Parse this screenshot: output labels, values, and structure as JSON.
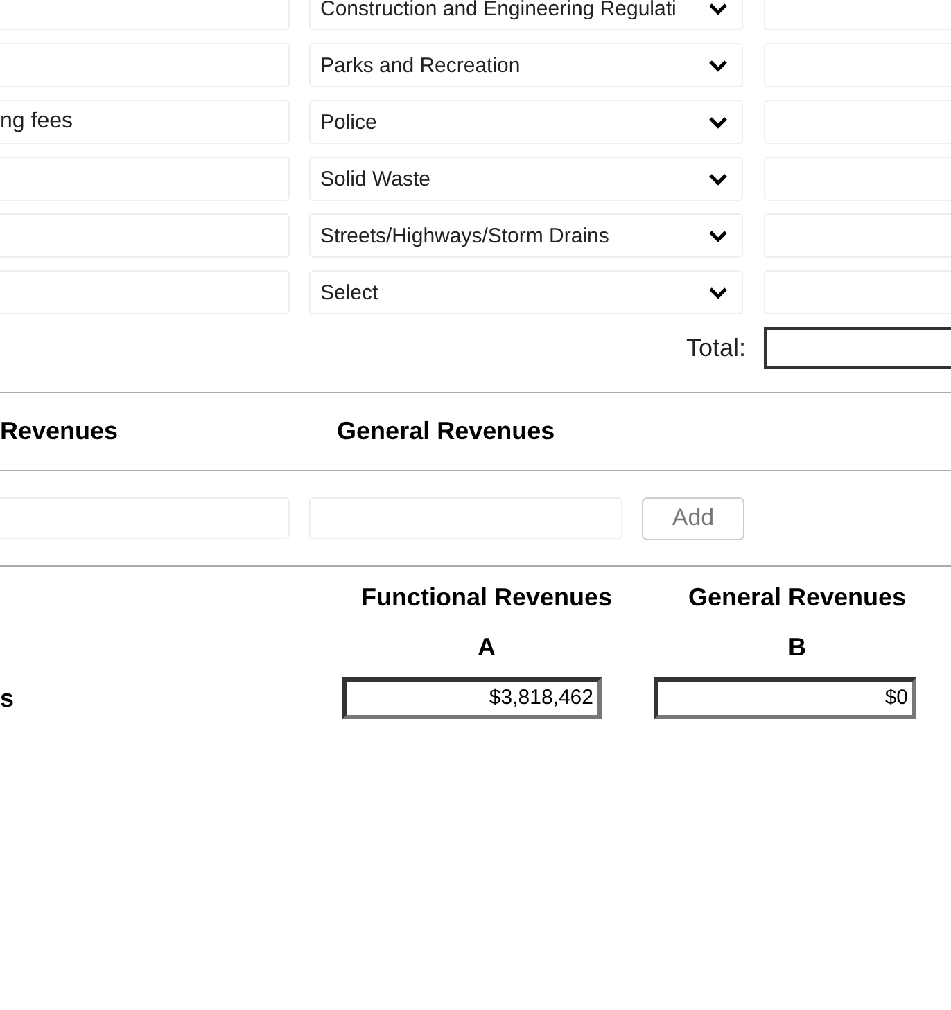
{
  "revenue_rows": [
    {
      "department": "Construction and Engineering Regulati"
    },
    {
      "department": "Parks and Recreation"
    },
    {
      "description": "ng fees",
      "department": "Police"
    },
    {
      "department": "Solid Waste"
    },
    {
      "department": "Streets/Highways/Storm Drains"
    },
    {
      "department": "Select"
    }
  ],
  "total_label": "Total:",
  "add_section": {
    "headings": [
      "Revenues",
      "General Revenues"
    ],
    "button": "Add"
  },
  "summary": {
    "columns": [
      {
        "heading": "Functional Revenues",
        "letter": "A",
        "value": "$3,818,462"
      },
      {
        "heading": "General Revenues",
        "letter": "B",
        "value": "$0"
      }
    ],
    "row_label": "s"
  }
}
